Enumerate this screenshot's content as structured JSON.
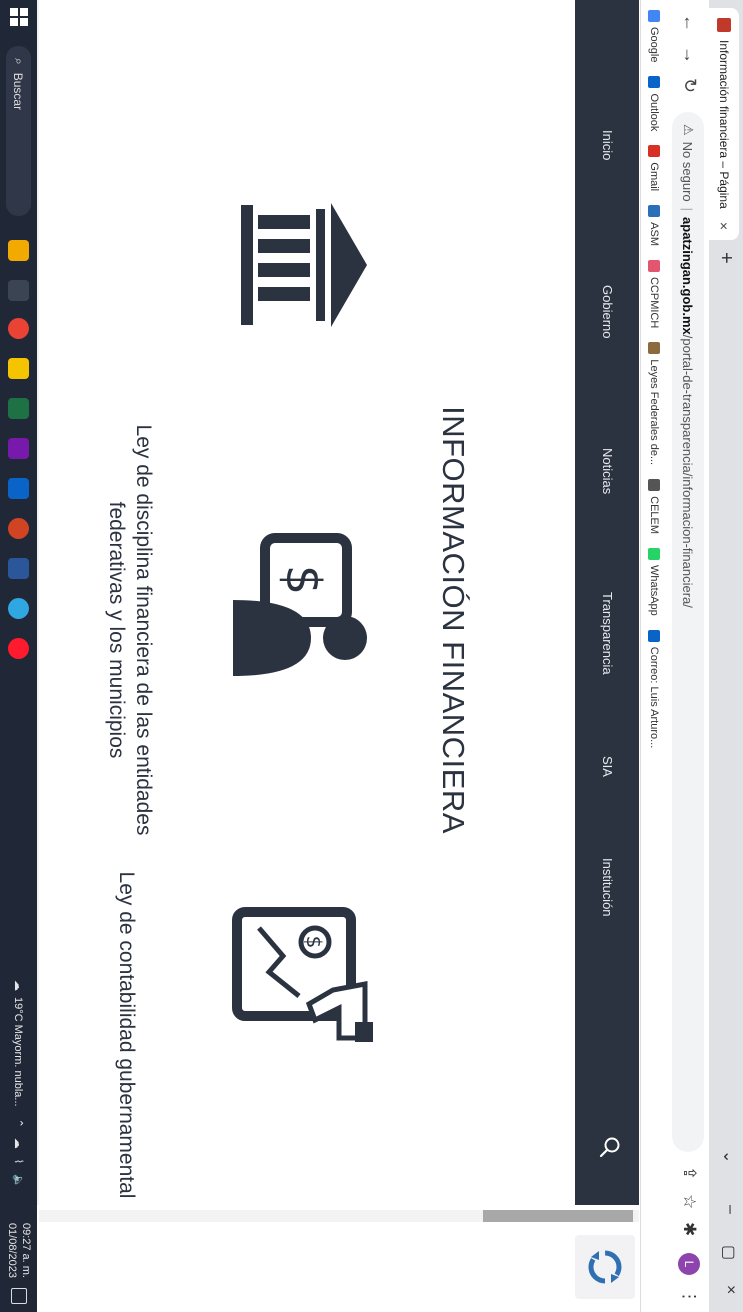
{
  "browser": {
    "tab_title": "Información financiera – Página",
    "tab_close": "×",
    "new_tab": "+",
    "window_controls": {
      "dropdown": "⌄",
      "minimize": "–",
      "restore": "▢",
      "close": "×"
    },
    "nav": {
      "back": "←",
      "forward": "→",
      "reload": "↻"
    },
    "security_label": "No seguro",
    "url_host": "apatzingan.gob.mx",
    "url_path": "/portal-de-transparencia/informacion-financiera/",
    "avatar_letter": "L",
    "bookmarks": [
      {
        "label": "Google",
        "color": "#4285f4"
      },
      {
        "label": "Outlook",
        "color": "#0a64c8"
      },
      {
        "label": "Gmail",
        "color": "#d93025"
      },
      {
        "label": "ASM",
        "color": "#2a6fb8"
      },
      {
        "label": "CCPMICH",
        "color": "#e3566f"
      },
      {
        "label": "Leyes Federales de...",
        "color": "#8b6b3d"
      },
      {
        "label": "CELEM",
        "color": "#555555"
      },
      {
        "label": "WhatsApp",
        "color": "#25d366"
      },
      {
        "label": "Correo: Luis Arturo...",
        "color": "#0a64c8"
      }
    ]
  },
  "site_nav": {
    "items": [
      "Inicio",
      "Gobierno",
      "Noticias",
      "Transparencia",
      "SIA",
      "Institución"
    ],
    "background": "#2c3340"
  },
  "page": {
    "heading": "INFORMACIÓN FINANCIERA",
    "law_left": "Ley de disciplina financiera de las entidades federativas y los municipios",
    "law_right": "Ley de contabilidad gubernamental",
    "icons": [
      "bank-icon",
      "financial-advisor-icon",
      "financial-report-icon"
    ],
    "accent_color": "#2c3340"
  },
  "taskbar": {
    "search_placeholder": "Buscar",
    "weather": "19°C  Mayorm. nubla...",
    "time": "09:27 a. m.",
    "date": "01/08/2023"
  }
}
